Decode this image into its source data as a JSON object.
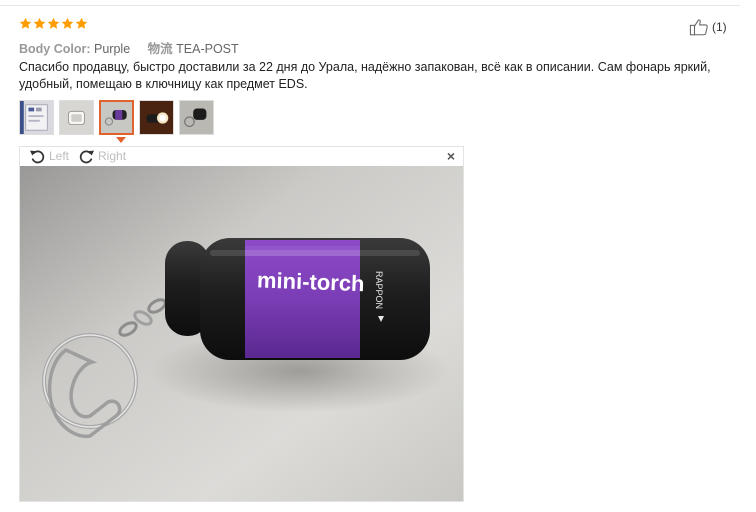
{
  "review": {
    "rating": 5,
    "like_count": "(1)",
    "meta": {
      "color_key": "Body Color:",
      "color_value": "Purple",
      "shipping_key": "物流",
      "shipping_value": "TEA-POST"
    },
    "text": "Спасибо продавцу, быстро доставили за 22 дня до Урала, надёжно запакован, всё как в описании. Сам фонарь яркий, удобный, помещаю в ключницу как предмет EDS."
  },
  "thumbnails": {
    "count": 5,
    "active_index": 2
  },
  "viewer": {
    "rotate_left_label": "Left",
    "rotate_right_label": "Right",
    "close_label": "×",
    "product_label": "mini-torch",
    "side_label": "RAPPON"
  },
  "colors": {
    "star": "#ff9c00",
    "active_border": "#e0622d",
    "torch_purple": "#7b3db5"
  },
  "icons": [
    "star-icon",
    "thumbs-up-icon",
    "rotate-left-icon",
    "rotate-right-icon",
    "close-icon"
  ]
}
